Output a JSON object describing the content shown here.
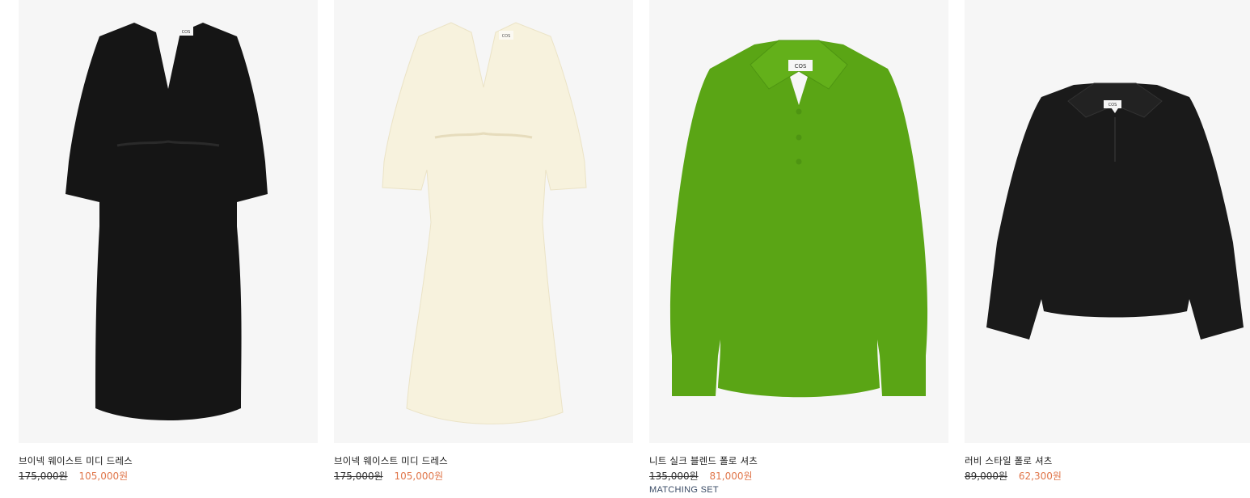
{
  "products": [
    {
      "name": "브이넥 웨이스트 미디 드레스",
      "old_price": "175,000원",
      "sale_price": "105,000원",
      "color": "#151515",
      "brand_label": "COS"
    },
    {
      "name": "브이넥 웨이스트 미디 드레스",
      "old_price": "175,000원",
      "sale_price": "105,000원",
      "color": "#f7f2dd",
      "brand_label": "COS"
    },
    {
      "name": "니트 실크 블렌드 폴로 셔츠",
      "old_price": "135,000원",
      "sale_price": "81,000원",
      "badge": "MATCHING SET",
      "color": "#5aa515",
      "brand_label": "COS"
    },
    {
      "name": "러비 스타일 폴로 셔츠",
      "old_price": "89,000원",
      "sale_price": "62,300원",
      "color": "#1a1a1a",
      "brand_label": "COS"
    }
  ],
  "colors": {
    "sale": "#e0764a",
    "badge": "#3b4c66",
    "image_bg": "#f6f6f6"
  }
}
